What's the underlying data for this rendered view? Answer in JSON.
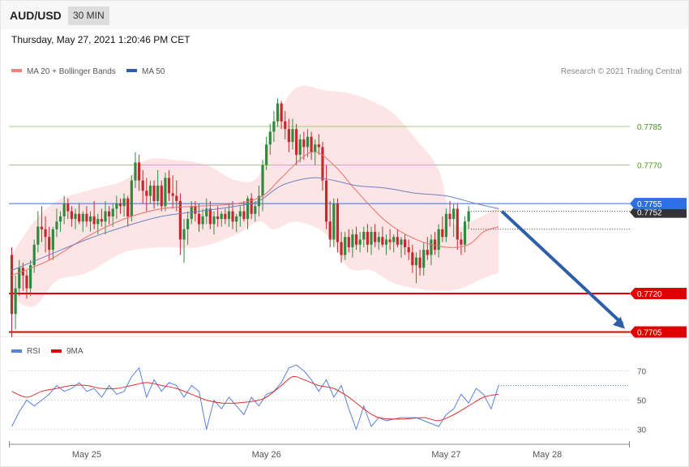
{
  "header": {
    "pair": "AUD/USD",
    "timeframe": "30 MIN",
    "datetime": "Thursday, May 27, 2021 1:20:46 PM CET"
  },
  "legend": {
    "ma20": "MA 20 + Bollinger Bands",
    "ma50": "MA 50",
    "credit": "Research © 2021 Trading Central"
  },
  "rsi_legend": {
    "rsi": "RSI",
    "ma9": "9MA"
  },
  "colors": {
    "bull": "#2e8b3e",
    "bear": "#c8282d",
    "ma20": "#ee6e6e",
    "ma50": "#7080c0",
    "band": "#fde0e0",
    "support": "#e00000",
    "resistance": "#9ccf7a",
    "current": "#2d6fe6",
    "arrow": "#2f5ea8",
    "rsi": "#5a80e0",
    "rsi_ma": "#e03030"
  },
  "chart_data": {
    "type": "candlestick",
    "pair": "AUD/USD",
    "timeframe": "30 MIN",
    "ylim": [
      0.7702,
      0.7803
    ],
    "x_labels": [
      "May 25",
      "May 26",
      "May 27",
      "May 28"
    ],
    "x_label_index": [
      20,
      68,
      116,
      143
    ],
    "candles": [
      [
        0.7735,
        0.7738,
        0.7703,
        0.7712
      ],
      [
        0.7712,
        0.7727,
        0.7706,
        0.7722
      ],
      [
        0.7722,
        0.7733,
        0.7719,
        0.773
      ],
      [
        0.773,
        0.7732,
        0.7721,
        0.7727
      ],
      [
        0.7727,
        0.7729,
        0.7718,
        0.7722
      ],
      [
        0.7722,
        0.7733,
        0.7719,
        0.7731
      ],
      [
        0.7731,
        0.7741,
        0.7728,
        0.7739
      ],
      [
        0.7739,
        0.7752,
        0.7736,
        0.7746
      ],
      [
        0.7746,
        0.7754,
        0.774,
        0.7745
      ],
      [
        0.7745,
        0.775,
        0.7736,
        0.7742
      ],
      [
        0.7742,
        0.7746,
        0.7733,
        0.7737
      ],
      [
        0.7737,
        0.7746,
        0.7733,
        0.7745
      ],
      [
        0.7745,
        0.7753,
        0.7742,
        0.7748
      ],
      [
        0.7748,
        0.7752,
        0.7744,
        0.775
      ],
      [
        0.775,
        0.7758,
        0.7747,
        0.7755
      ],
      [
        0.7755,
        0.7757,
        0.7749,
        0.7752
      ],
      [
        0.7752,
        0.7754,
        0.7746,
        0.7749
      ],
      [
        0.7749,
        0.7753,
        0.7745,
        0.7751
      ],
      [
        0.7751,
        0.7755,
        0.7747,
        0.7748
      ],
      [
        0.7748,
        0.7752,
        0.7744,
        0.7751
      ],
      [
        0.7751,
        0.7754,
        0.7746,
        0.7748
      ],
      [
        0.7748,
        0.7752,
        0.7744,
        0.775
      ],
      [
        0.775,
        0.7756,
        0.7745,
        0.7747
      ],
      [
        0.7747,
        0.7751,
        0.7743,
        0.7749
      ],
      [
        0.7749,
        0.7753,
        0.7746,
        0.7748
      ],
      [
        0.7748,
        0.7756,
        0.7743,
        0.7752
      ],
      [
        0.7752,
        0.7754,
        0.7747,
        0.775
      ],
      [
        0.775,
        0.7755,
        0.7746,
        0.7753
      ],
      [
        0.7753,
        0.7758,
        0.7749,
        0.7755
      ],
      [
        0.7755,
        0.7757,
        0.7751,
        0.7754
      ],
      [
        0.7754,
        0.7759,
        0.775,
        0.7757
      ],
      [
        0.7757,
        0.7758,
        0.7746,
        0.775
      ],
      [
        0.775,
        0.7766,
        0.7748,
        0.7764
      ],
      [
        0.7764,
        0.7775,
        0.7761,
        0.7771
      ],
      [
        0.7771,
        0.7774,
        0.776,
        0.7764
      ],
      [
        0.7764,
        0.7768,
        0.7755,
        0.776
      ],
      [
        0.776,
        0.7765,
        0.7752,
        0.7758
      ],
      [
        0.7758,
        0.7764,
        0.7755,
        0.7762
      ],
      [
        0.7762,
        0.7764,
        0.7753,
        0.7756
      ],
      [
        0.7756,
        0.7768,
        0.7754,
        0.7762
      ],
      [
        0.7762,
        0.7764,
        0.7752,
        0.7754
      ],
      [
        0.7754,
        0.7767,
        0.7752,
        0.7765
      ],
      [
        0.7765,
        0.7768,
        0.7756,
        0.7759
      ],
      [
        0.7759,
        0.7766,
        0.7753,
        0.7758
      ],
      [
        0.7758,
        0.7764,
        0.7752,
        0.7756
      ],
      [
        0.7756,
        0.7759,
        0.7735,
        0.7741
      ],
      [
        0.7741,
        0.7749,
        0.7732,
        0.7745
      ],
      [
        0.7745,
        0.7752,
        0.7739,
        0.7749
      ],
      [
        0.7749,
        0.7756,
        0.7747,
        0.7754
      ],
      [
        0.7754,
        0.7756,
        0.7748,
        0.7751
      ],
      [
        0.7751,
        0.7755,
        0.7744,
        0.7747
      ],
      [
        0.7747,
        0.7753,
        0.7745,
        0.775
      ],
      [
        0.775,
        0.7757,
        0.7747,
        0.7753
      ],
      [
        0.7753,
        0.7756,
        0.7745,
        0.7747
      ],
      [
        0.7747,
        0.7752,
        0.7743,
        0.775
      ],
      [
        0.775,
        0.7754,
        0.7746,
        0.7749
      ],
      [
        0.7749,
        0.7752,
        0.7746,
        0.7751
      ],
      [
        0.7751,
        0.7753,
        0.7747,
        0.7749
      ],
      [
        0.7749,
        0.7755,
        0.7746,
        0.7752
      ],
      [
        0.7752,
        0.7756,
        0.7745,
        0.7748
      ],
      [
        0.7748,
        0.7751,
        0.7744,
        0.775
      ],
      [
        0.775,
        0.7754,
        0.7746,
        0.7752
      ],
      [
        0.7752,
        0.7756,
        0.7748,
        0.7749
      ],
      [
        0.7749,
        0.7758,
        0.7745,
        0.7757
      ],
      [
        0.7757,
        0.7759,
        0.7749,
        0.7751
      ],
      [
        0.7751,
        0.7756,
        0.7748,
        0.7754
      ],
      [
        0.7754,
        0.7762,
        0.775,
        0.7758
      ],
      [
        0.7758,
        0.7772,
        0.7752,
        0.777
      ],
      [
        0.777,
        0.7781,
        0.7768,
        0.7778
      ],
      [
        0.7778,
        0.7786,
        0.7774,
        0.7783
      ],
      [
        0.7783,
        0.7791,
        0.7779,
        0.7787
      ],
      [
        0.7787,
        0.7796,
        0.7785,
        0.7794
      ],
      [
        0.7794,
        0.7795,
        0.7784,
        0.7787
      ],
      [
        0.7787,
        0.7791,
        0.778,
        0.7784
      ],
      [
        0.7784,
        0.7788,
        0.7775,
        0.7779
      ],
      [
        0.7779,
        0.7788,
        0.7776,
        0.7784
      ],
      [
        0.7784,
        0.7786,
        0.777,
        0.7774
      ],
      [
        0.7774,
        0.7782,
        0.7771,
        0.778
      ],
      [
        0.778,
        0.7783,
        0.7772,
        0.7777
      ],
      [
        0.7777,
        0.7784,
        0.7773,
        0.7781
      ],
      [
        0.7781,
        0.7783,
        0.7772,
        0.7775
      ],
      [
        0.7775,
        0.778,
        0.777,
        0.7778
      ],
      [
        0.7778,
        0.7782,
        0.7774,
        0.7777
      ],
      [
        0.7777,
        0.7779,
        0.776,
        0.7764
      ],
      [
        0.7764,
        0.777,
        0.7745,
        0.7748
      ],
      [
        0.7748,
        0.7756,
        0.7738,
        0.7741
      ],
      [
        0.7741,
        0.7757,
        0.7738,
        0.7755
      ],
      [
        0.7755,
        0.7757,
        0.7736,
        0.774
      ],
      [
        0.774,
        0.7744,
        0.7732,
        0.7735
      ],
      [
        0.7735,
        0.7744,
        0.7733,
        0.7742
      ],
      [
        0.7742,
        0.7745,
        0.7736,
        0.7738
      ],
      [
        0.7738,
        0.7745,
        0.7734,
        0.7743
      ],
      [
        0.7743,
        0.7746,
        0.7737,
        0.7739
      ],
      [
        0.7739,
        0.7744,
        0.7736,
        0.7741
      ],
      [
        0.7741,
        0.7746,
        0.7738,
        0.7744
      ],
      [
        0.7744,
        0.7747,
        0.7736,
        0.7739
      ],
      [
        0.7739,
        0.7746,
        0.7735,
        0.7744
      ],
      [
        0.7744,
        0.7747,
        0.7738,
        0.774
      ],
      [
        0.774,
        0.7744,
        0.7737,
        0.7742
      ],
      [
        0.7742,
        0.7746,
        0.7738,
        0.7739
      ],
      [
        0.7739,
        0.7743,
        0.7735,
        0.7741
      ],
      [
        0.7741,
        0.7745,
        0.7737,
        0.774
      ],
      [
        0.774,
        0.7743,
        0.7736,
        0.7742
      ],
      [
        0.7742,
        0.7745,
        0.7738,
        0.7739
      ],
      [
        0.7739,
        0.7742,
        0.7734,
        0.7741
      ],
      [
        0.7741,
        0.7743,
        0.7735,
        0.7738
      ],
      [
        0.7738,
        0.7741,
        0.7733,
        0.7736
      ],
      [
        0.7736,
        0.7739,
        0.7728,
        0.7731
      ],
      [
        0.7731,
        0.7736,
        0.7724,
        0.7734
      ],
      [
        0.7734,
        0.7737,
        0.7727,
        0.773
      ],
      [
        0.773,
        0.774,
        0.7727,
        0.7737
      ],
      [
        0.7737,
        0.7742,
        0.7733,
        0.7735
      ],
      [
        0.7735,
        0.7743,
        0.7731,
        0.7741
      ],
      [
        0.7741,
        0.7744,
        0.7735,
        0.7737
      ],
      [
        0.7737,
        0.7747,
        0.7734,
        0.7745
      ],
      [
        0.7745,
        0.775,
        0.774,
        0.7742
      ],
      [
        0.7742,
        0.7753,
        0.774,
        0.7751
      ],
      [
        0.7751,
        0.7756,
        0.7746,
        0.7749
      ],
      [
        0.7749,
        0.7755,
        0.7742,
        0.7753
      ],
      [
        0.7753,
        0.7755,
        0.7737,
        0.7741
      ],
      [
        0.7741,
        0.7744,
        0.7735,
        0.7739
      ],
      [
        0.7739,
        0.775,
        0.7736,
        0.7748
      ],
      [
        0.7748,
        0.7754,
        0.7745,
        0.7752
      ]
    ],
    "ma20": [
      [
        0,
        0.7727
      ],
      [
        10,
        0.7733
      ],
      [
        20,
        0.7742
      ],
      [
        30,
        0.7749
      ],
      [
        40,
        0.7753
      ],
      [
        50,
        0.7754
      ],
      [
        60,
        0.7755
      ],
      [
        67,
        0.7758
      ],
      [
        72,
        0.7765
      ],
      [
        80,
        0.7775
      ],
      [
        86,
        0.777
      ],
      [
        92,
        0.776
      ],
      [
        100,
        0.7748
      ],
      [
        108,
        0.7741
      ],
      [
        116,
        0.7738
      ],
      [
        122,
        0.7739
      ],
      [
        126,
        0.7744
      ],
      [
        130,
        0.7746
      ]
    ],
    "ma50": [
      [
        0,
        0.7729
      ],
      [
        10,
        0.7735
      ],
      [
        20,
        0.7741
      ],
      [
        30,
        0.7746
      ],
      [
        40,
        0.775
      ],
      [
        50,
        0.7752
      ],
      [
        60,
        0.7754
      ],
      [
        66,
        0.7756
      ],
      [
        72,
        0.7762
      ],
      [
        80,
        0.7765
      ],
      [
        86,
        0.7764
      ],
      [
        92,
        0.7762
      ],
      [
        100,
        0.7761
      ],
      [
        108,
        0.7759
      ],
      [
        116,
        0.7758
      ],
      [
        124,
        0.7755
      ],
      [
        130,
        0.7753
      ]
    ],
    "bb_upper": [
      [
        0,
        0.7735
      ],
      [
        6,
        0.7748
      ],
      [
        12,
        0.7756
      ],
      [
        20,
        0.776
      ],
      [
        30,
        0.7764
      ],
      [
        36,
        0.7772
      ],
      [
        44,
        0.7772
      ],
      [
        52,
        0.777
      ],
      [
        60,
        0.7764
      ],
      [
        66,
        0.7766
      ],
      [
        70,
        0.7786
      ],
      [
        76,
        0.78
      ],
      [
        84,
        0.7799
      ],
      [
        90,
        0.7798
      ],
      [
        96,
        0.7795
      ],
      [
        102,
        0.779
      ],
      [
        108,
        0.778
      ],
      [
        114,
        0.7768
      ],
      [
        118,
        0.7747
      ],
      [
        124,
        0.7749
      ],
      [
        130,
        0.7754
      ]
    ],
    "bb_lower": [
      [
        0,
        0.7718
      ],
      [
        6,
        0.7715
      ],
      [
        12,
        0.7725
      ],
      [
        20,
        0.7728
      ],
      [
        30,
        0.7736
      ],
      [
        40,
        0.7738
      ],
      [
        50,
        0.7738
      ],
      [
        60,
        0.7743
      ],
      [
        66,
        0.7748
      ],
      [
        70,
        0.7745
      ],
      [
        76,
        0.7748
      ],
      [
        84,
        0.7743
      ],
      [
        90,
        0.773
      ],
      [
        96,
        0.7729
      ],
      [
        102,
        0.7724
      ],
      [
        108,
        0.7722
      ],
      [
        114,
        0.7721
      ],
      [
        120,
        0.7722
      ],
      [
        126,
        0.7726
      ],
      [
        130,
        0.7728
      ]
    ],
    "levels": [
      {
        "value": 0.7785,
        "label": "0.7785",
        "kind": "resistance"
      },
      {
        "value": 0.777,
        "label": "0.7770",
        "kind": "resistance"
      },
      {
        "value": 0.7755,
        "label": "0.7755",
        "kind": "current"
      },
      {
        "value": 0.7752,
        "label": "0.7752",
        "kind": "last"
      },
      {
        "value": 0.772,
        "label": "0.7720",
        "kind": "support"
      },
      {
        "value": 0.7705,
        "label": "0.7705",
        "kind": "support"
      }
    ],
    "arrow": {
      "from": [
        130,
        0.7752
      ],
      "to": [
        142,
        0.7705
      ]
    },
    "rsi": {
      "ylim": [
        22,
        78
      ],
      "ticks": [
        {
          "value": 70,
          "label": "70"
        },
        {
          "value": 50,
          "label": "50"
        },
        {
          "value": 30,
          "label": "30"
        }
      ],
      "rsi_values": [
        [
          0,
          32
        ],
        [
          2,
          42
        ],
        [
          4,
          50
        ],
        [
          6,
          46
        ],
        [
          8,
          50
        ],
        [
          10,
          54
        ],
        [
          12,
          60
        ],
        [
          14,
          56
        ],
        [
          16,
          58
        ],
        [
          18,
          62
        ],
        [
          20,
          56
        ],
        [
          22,
          58
        ],
        [
          24,
          52
        ],
        [
          26,
          60
        ],
        [
          28,
          54
        ],
        [
          30,
          56
        ],
        [
          32,
          66
        ],
        [
          34,
          72
        ],
        [
          36,
          52
        ],
        [
          38,
          64
        ],
        [
          40,
          56
        ],
        [
          42,
          62
        ],
        [
          44,
          60
        ],
        [
          46,
          52
        ],
        [
          48,
          60
        ],
        [
          50,
          56
        ],
        [
          52,
          30
        ],
        [
          54,
          50
        ],
        [
          56,
          44
        ],
        [
          58,
          52
        ],
        [
          60,
          46
        ],
        [
          62,
          40
        ],
        [
          64,
          52
        ],
        [
          66,
          46
        ],
        [
          68,
          54
        ],
        [
          70,
          56
        ],
        [
          72,
          62
        ],
        [
          74,
          72
        ],
        [
          76,
          74
        ],
        [
          78,
          70
        ],
        [
          80,
          64
        ],
        [
          82,
          56
        ],
        [
          84,
          64
        ],
        [
          86,
          52
        ],
        [
          88,
          60
        ],
        [
          90,
          44
        ],
        [
          92,
          30
        ],
        [
          94,
          46
        ],
        [
          96,
          32
        ],
        [
          98,
          38
        ],
        [
          100,
          36
        ],
        [
          104,
          38
        ],
        [
          108,
          38
        ],
        [
          112,
          34
        ],
        [
          114,
          32
        ],
        [
          116,
          40
        ],
        [
          118,
          44
        ],
        [
          120,
          54
        ],
        [
          122,
          48
        ],
        [
          124,
          58
        ],
        [
          126,
          54
        ],
        [
          128,
          44
        ],
        [
          130,
          60
        ]
      ],
      "rsi_ma": [
        [
          0,
          56
        ],
        [
          4,
          52
        ],
        [
          8,
          56
        ],
        [
          12,
          58
        ],
        [
          16,
          60
        ],
        [
          20,
          60
        ],
        [
          24,
          58
        ],
        [
          28,
          58
        ],
        [
          32,
          60
        ],
        [
          36,
          62
        ],
        [
          40,
          60
        ],
        [
          44,
          58
        ],
        [
          48,
          54
        ],
        [
          52,
          50
        ],
        [
          56,
          48
        ],
        [
          60,
          48
        ],
        [
          64,
          49
        ],
        [
          66,
          50
        ],
        [
          68,
          52
        ],
        [
          72,
          60
        ],
        [
          75,
          66
        ],
        [
          78,
          64
        ],
        [
          82,
          60
        ],
        [
          86,
          58
        ],
        [
          90,
          52
        ],
        [
          94,
          44
        ],
        [
          98,
          38
        ],
        [
          104,
          37
        ],
        [
          110,
          38
        ],
        [
          114,
          36
        ],
        [
          118,
          40
        ],
        [
          122,
          46
        ],
        [
          126,
          52
        ],
        [
          130,
          54
        ]
      ]
    }
  }
}
